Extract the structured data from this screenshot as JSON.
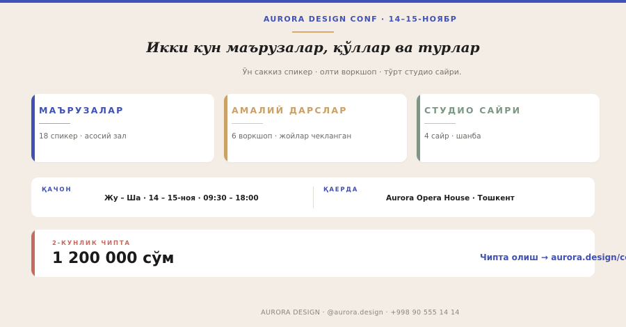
{
  "colors": {
    "indigo": "#3f51b5",
    "gold": "#c9a066",
    "sage": "#7d9683",
    "coral": "#c66a5f",
    "background": "#f4ede6"
  },
  "header": {
    "eyebrow": "AURORA DESIGN CONF · 14–15-НОЯБР",
    "headline": "Икки кун маърузалар, қўллар ва турлар",
    "subline": "Ўн саккиз спикер · олти воркшоп · тўрт студио сайри."
  },
  "tracks": [
    {
      "title": "МАЪРУЗАЛАР",
      "desc": "18 спикер · асосий зал",
      "color": "#3f51b5"
    },
    {
      "title": "АМАЛИЙ ДАРСЛАР",
      "desc": "6 воркшоп · жойлар чекланган",
      "color": "#c9a066"
    },
    {
      "title": "СТУДИО САЙРИ",
      "desc": "4 сайр · шанба",
      "color": "#7d9683"
    }
  ],
  "info": {
    "when_label": "ҚАЧОН",
    "when_value": "Жу – Ша · 14 – 15-ноя · 09:30 – 18:00",
    "where_label": "ҚАЕРДА",
    "where_value": "Aurora Opera House · Тошкент"
  },
  "ticket": {
    "label": "2-КУНЛИК ЧИПТА",
    "price": "1 200 000 сўм",
    "cta": "Чипта олиш → aurora.design/conf"
  },
  "footer": {
    "text": "AURORA DESIGN · @aurora.design · +998 90 555 14 14"
  }
}
